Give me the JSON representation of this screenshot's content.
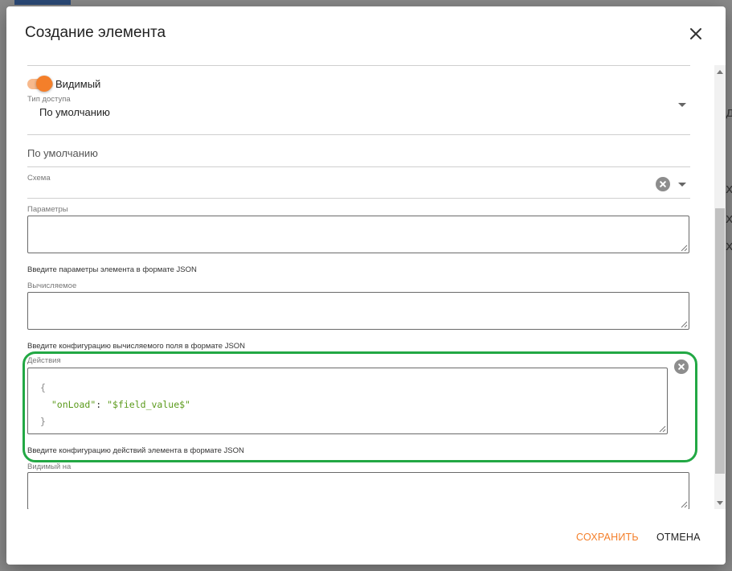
{
  "dialog": {
    "title": "Создание элемента",
    "close_icon": "close-icon"
  },
  "fields": {
    "visible_toggle": {
      "label": "Видимый",
      "on": true
    },
    "access_type": {
      "label": "Тип доступа",
      "value": "По умолчанию"
    },
    "default_value": {
      "text": "По умолчанию"
    },
    "schema": {
      "label": "Схема",
      "value": ""
    },
    "parameters": {
      "label": "Параметры",
      "value": "",
      "hint": "Введите параметры элемента в формате JSON"
    },
    "computed": {
      "label": "Вычисляемое",
      "value": "",
      "hint": "Введите конфигурацию вычисляемого поля в формате JSON"
    },
    "actions": {
      "label": "Действия",
      "code_open": "{",
      "code_key": "\"onLoad\"",
      "code_colon": ": ",
      "code_value": "\"$field_value$\"",
      "code_close": "}",
      "hint": "Введите конфигурацию действий элемента в формате JSON"
    },
    "visible_on": {
      "label": "Видимый на",
      "value": ""
    }
  },
  "footer": {
    "save_label": "СОХРАНИТЬ",
    "cancel_label": "ОТМЕНА"
  },
  "colors": {
    "accent": "#f47f2a",
    "highlight": "#22a844"
  }
}
